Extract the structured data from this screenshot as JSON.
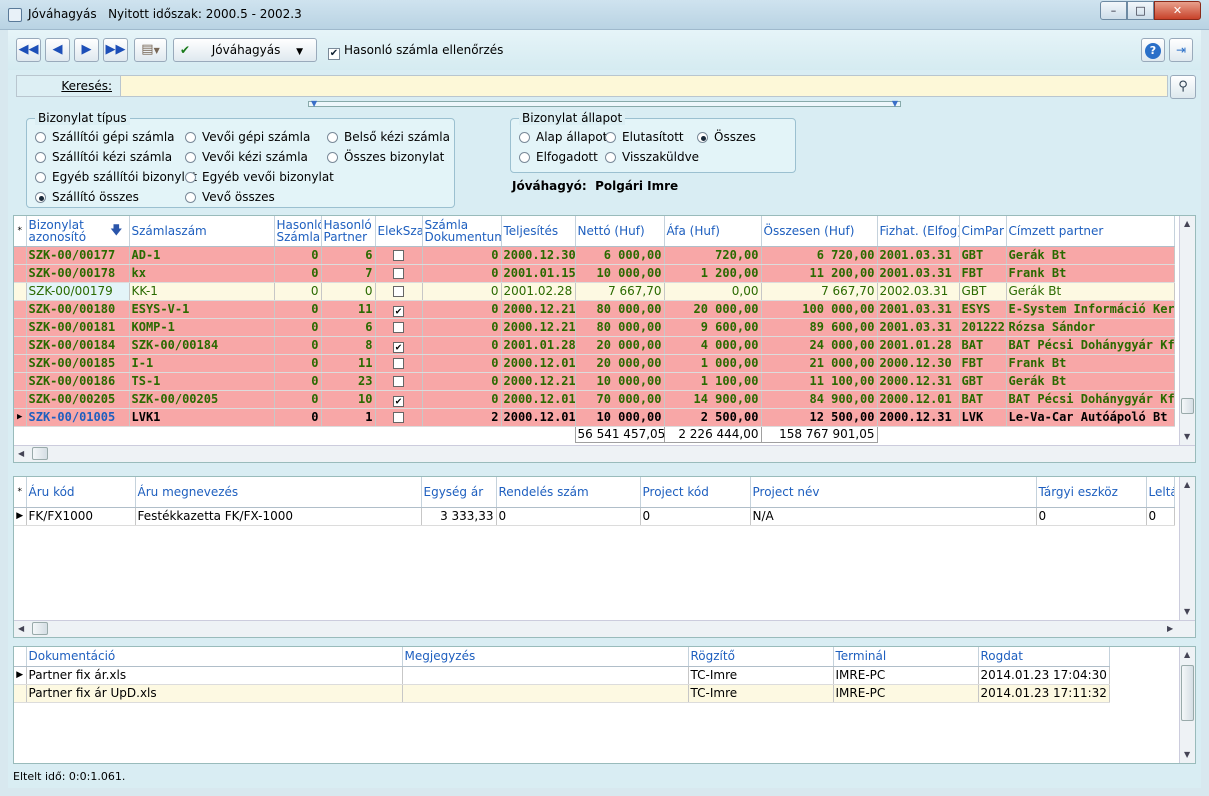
{
  "window": {
    "title": "Jóváhagyás",
    "period_label": "Nyitott időszak: 2000.5 - 2002.3",
    "min_glyph": "–",
    "max_glyph": "□",
    "close_glyph": "✕"
  },
  "toolbar": {
    "approve_label": "Jóváhagyás",
    "similar_check_label": "Hasonló számla ellenőrzés",
    "similar_checked": true,
    "icons": [
      "first-record-icon",
      "prev-record-icon",
      "next-record-icon",
      "last-record-icon",
      "print-icon",
      "help-icon",
      "exit-icon"
    ]
  },
  "search": {
    "label": "Keresés:",
    "value": ""
  },
  "doc_type": {
    "title": "Bizonylat típus",
    "options": [
      "Szállítói gépi számla",
      "Vevői gépi számla",
      "Belső kézi számla",
      "Szállítói kézi számla",
      "Vevői kézi számla",
      "Összes bizonylat",
      "Egyéb szállítói bizonylat",
      "Egyéb vevői bizonylat",
      "Szállító összes",
      "Vevő összes"
    ],
    "selected": "Szállító összes"
  },
  "doc_state": {
    "title": "Bizonylat állapot",
    "options": [
      "Alap állapot",
      "Elutasított",
      "Összes",
      "Elfogadott",
      "Visszaküldve"
    ],
    "selected": "Összes"
  },
  "approver": {
    "label": "Jóváhagyó:",
    "name": "Polgári Imre"
  },
  "invoices": {
    "columns": [
      "Bizonylat azonosító",
      "Számlaszám",
      "Hasonló Számla",
      "Hasonló Partner",
      "ElekSzal",
      "Számla Dokumentum",
      "Teljesítés",
      "Nettó (Huf)",
      "Áfa (Huf)",
      "Összesen (Huf)",
      "Fizhat. (Elfog)",
      "CimPar",
      "Címzett partner"
    ],
    "rows": [
      {
        "id": "SZK-00/00177",
        "szamlaszam": "AD-1",
        "hs": "0",
        "hp": "6",
        "elek": false,
        "dok": "0",
        "telj": "2000.12.30",
        "netto": "6 000,00",
        "afa": "720,00",
        "ossz": "6 720,00",
        "fiz": "2001.03.31",
        "cimpar": "GBT",
        "partner": "Gerák Bt",
        "style": "pink"
      },
      {
        "id": "SZK-00/00178",
        "szamlaszam": "kx",
        "hs": "0",
        "hp": "7",
        "elek": false,
        "dok": "0",
        "telj": "2001.01.15",
        "netto": "10 000,00",
        "afa": "1 200,00",
        "ossz": "11 200,00",
        "fiz": "2001.03.31",
        "cimpar": "FBT",
        "partner": "Frank Bt",
        "style": "pink"
      },
      {
        "id": "SZK-00/00179",
        "szamlaszam": "KK-1",
        "hs": "0",
        "hp": "0",
        "elek": false,
        "dok": "0",
        "telj": "2001.02.28",
        "netto": "7 667,70",
        "afa": "0,00",
        "ossz": "7 667,70",
        "fiz": "2002.03.31",
        "cimpar": "GBT",
        "partner": "Gerák Bt",
        "style": "cream"
      },
      {
        "id": "SZK-00/00180",
        "szamlaszam": "ESYS-V-1",
        "hs": "0",
        "hp": "11",
        "elek": true,
        "dok": "0",
        "telj": "2000.12.21",
        "netto": "80 000,00",
        "afa": "20 000,00",
        "ossz": "100 000,00",
        "fiz": "2001.03.31",
        "cimpar": "ESYS",
        "partner": "E-System Információ Keres",
        "style": "pink"
      },
      {
        "id": "SZK-00/00181",
        "szamlaszam": "KOMP-1",
        "hs": "0",
        "hp": "6",
        "elek": false,
        "dok": "0",
        "telj": "2000.12.21",
        "netto": "80 000,00",
        "afa": "9 600,00",
        "ossz": "89 600,00",
        "fiz": "2001.03.31",
        "cimpar": "201222",
        "partner": "Rózsa Sándor",
        "style": "pink"
      },
      {
        "id": "SZK-00/00184",
        "szamlaszam": "SZK-00/00184",
        "hs": "0",
        "hp": "8",
        "elek": true,
        "dok": "0",
        "telj": "2001.01.28",
        "netto": "20 000,00",
        "afa": "4 000,00",
        "ossz": "24 000,00",
        "fiz": "2001.01.28",
        "cimpar": "BAT",
        "partner": "BAT Pécsi Dohánygyár Kft",
        "style": "pink"
      },
      {
        "id": "SZK-00/00185",
        "szamlaszam": "I-1",
        "hs": "0",
        "hp": "11",
        "elek": false,
        "dok": "0",
        "telj": "2000.12.01",
        "netto": "20 000,00",
        "afa": "1 000,00",
        "ossz": "21 000,00",
        "fiz": "2000.12.30",
        "cimpar": "FBT",
        "partner": "Frank Bt",
        "style": "pink"
      },
      {
        "id": "SZK-00/00186",
        "szamlaszam": "TS-1",
        "hs": "0",
        "hp": "23",
        "elek": false,
        "dok": "0",
        "telj": "2000.12.21",
        "netto": "10 000,00",
        "afa": "1 100,00",
        "ossz": "11 100,00",
        "fiz": "2000.12.31",
        "cimpar": "GBT",
        "partner": "Gerák Bt",
        "style": "pink"
      },
      {
        "id": "SZK-00/00205",
        "szamlaszam": "SZK-00/00205",
        "hs": "0",
        "hp": "10",
        "elek": true,
        "dok": "0",
        "telj": "2000.12.01",
        "netto": "70 000,00",
        "afa": "14 900,00",
        "ossz": "84 900,00",
        "fiz": "2000.12.01",
        "cimpar": "BAT",
        "partner": "BAT Pécsi Dohánygyár Kft",
        "style": "pink"
      },
      {
        "id": "SZK-00/01005",
        "szamlaszam": "LVK1",
        "hs": "0",
        "hp": "1",
        "elek": false,
        "dok": "2",
        "telj": "2000.12.01",
        "netto": "10 000,00",
        "afa": "2 500,00",
        "ossz": "12 500,00",
        "fiz": "2000.12.31",
        "cimpar": "LVK",
        "partner": "Le-Va-Car Autóápoló Bt",
        "style": "curr"
      }
    ],
    "totals": {
      "netto": "56 541 457,05",
      "afa": "2 226 444,00",
      "ossz": "158 767 901,05"
    }
  },
  "items": {
    "columns": [
      "Áru kód",
      "Áru megnevezés",
      "Egység ár",
      "Rendelés szám",
      "Project kód",
      "Project név",
      "Tárgyi eszköz",
      "Leltá"
    ],
    "rows": [
      {
        "kod": "FK/FX1000",
        "nev": "Festékkazetta FK/FX-1000",
        "ar": "3 333,33",
        "rend": "0",
        "pkod": "0",
        "pnev": "N/A",
        "targy": "0",
        "lelt": "0"
      }
    ]
  },
  "docs": {
    "columns": [
      "Dokumentáció",
      "Megjegyzés",
      "Rögzítő",
      "Terminál",
      "Rogdat"
    ],
    "rows": [
      {
        "dok": "Partner fix ár.xls",
        "megj": "",
        "rogz": "TC-Imre",
        "term": "IMRE-PC",
        "datum": "2014.01.23 17:04:30"
      },
      {
        "dok": "Partner fix ár UpD.xls",
        "megj": "",
        "rogz": "TC-Imre",
        "term": "IMRE-PC",
        "datum": "2014.01.23 17:11:32"
      }
    ]
  },
  "status": {
    "elapsed": "Eltelt idő: 0:0:1.061."
  }
}
